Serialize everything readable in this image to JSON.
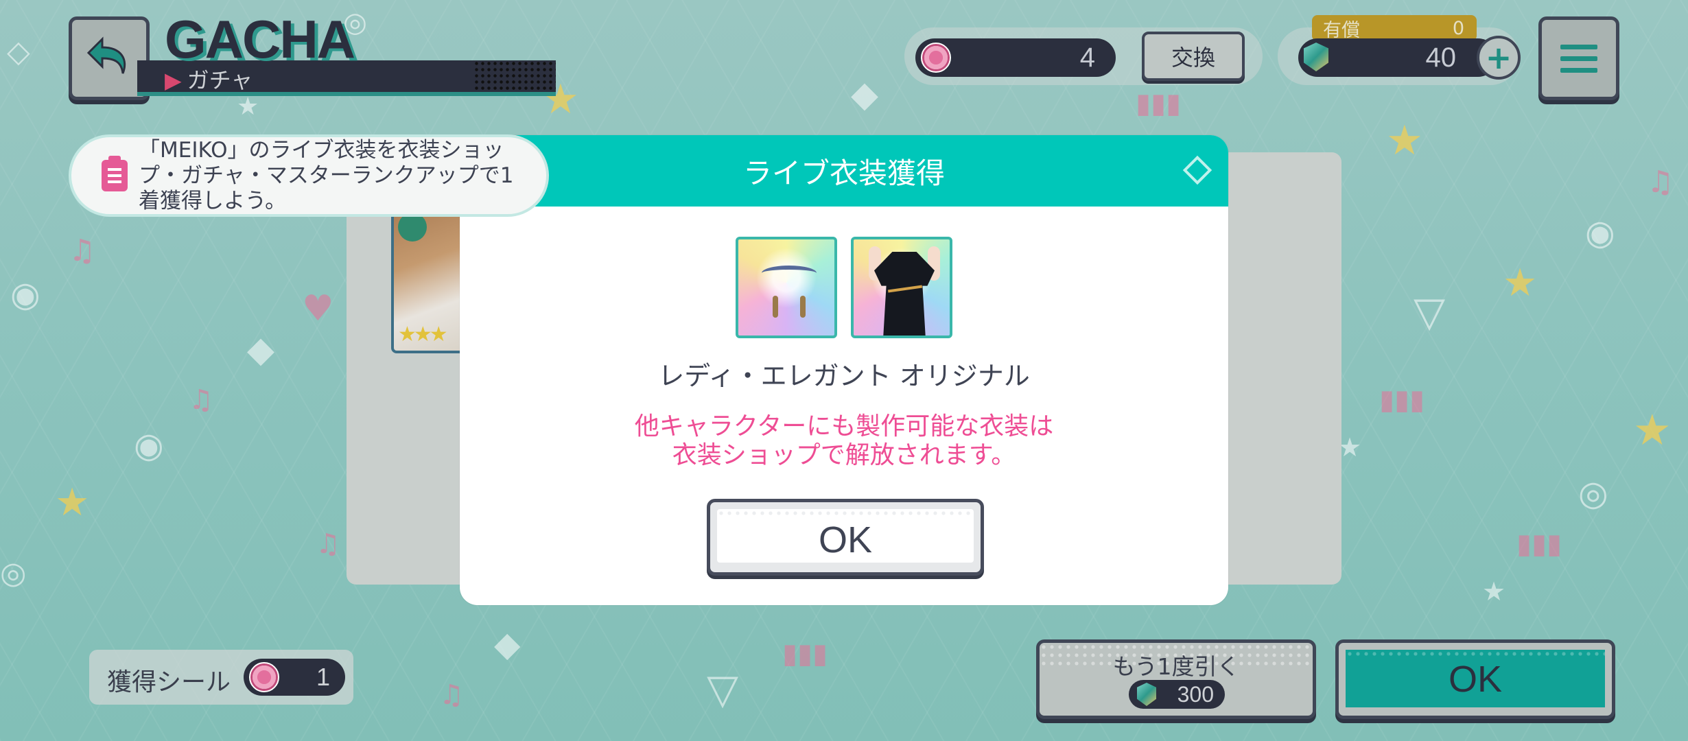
{
  "header": {
    "title_en": "GACHA",
    "title_jp": "ガチャ"
  },
  "resources": {
    "sticker_count": "4",
    "exchange_label": "交換",
    "paid_label": "有償",
    "paid_count": "0",
    "gem_count": "40",
    "plus_icon": "plus-icon"
  },
  "mission": {
    "text": "「MEIKO」のライブ衣装を衣装ショップ・ガチャ・マスターランクアップで1着獲得しよう。"
  },
  "modal": {
    "title": "ライブ衣装獲得",
    "outfit_name": "レディ・エレガント オリジナル",
    "notice_line1": "他キャラクターにも製作可能な衣装は",
    "notice_line2": "衣装ショップで解放されます。",
    "ok_label": "OK"
  },
  "bottom": {
    "sticker_label": "獲得シール",
    "sticker_value": "1",
    "again_label": "もう1度引く",
    "again_cost": "300",
    "ok_label": "OK"
  },
  "colors": {
    "accent": "#00c7b9",
    "notice": "#ee4d94",
    "dark": "#2b2f3e"
  }
}
